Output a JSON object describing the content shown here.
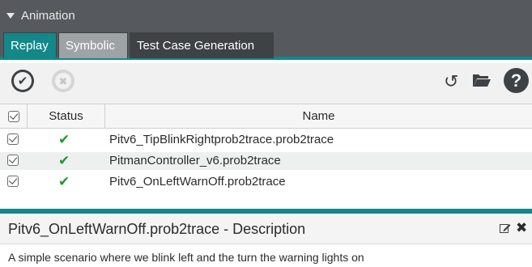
{
  "panel": {
    "title": "Animation"
  },
  "tabs": [
    {
      "label": "Replay",
      "state": "active"
    },
    {
      "label": "Symbolic",
      "state": "inactive"
    },
    {
      "label": "Test Case Generation",
      "state": "inactive"
    }
  ],
  "toolbar": {
    "icons": [
      "check-all-icon",
      "cancel-icon",
      "reload-icon",
      "folder-icon",
      "help-icon"
    ],
    "help_label": "?"
  },
  "table": {
    "columns": [
      "",
      "Status",
      "Name"
    ],
    "rows": [
      {
        "checked": true,
        "status": "✔",
        "name": "Pitv6_TipBlinkRightprob2trace.prob2trace"
      },
      {
        "checked": true,
        "status": "✔",
        "name": "PitmanController_v6.prob2trace"
      },
      {
        "checked": true,
        "status": "✔",
        "name": "Pitv6_OnLeftWarnOff.prob2trace"
      }
    ]
  },
  "description": {
    "title": "Pitv6_OnLeftWarnOff.prob2trace - Description",
    "text": "A simple scenario where we blink left and the turn the warning lights on",
    "close_label": "✖"
  },
  "colors": {
    "accent": "#13878a",
    "header_bg": "#565a5e",
    "success": "#1e9a2d"
  }
}
